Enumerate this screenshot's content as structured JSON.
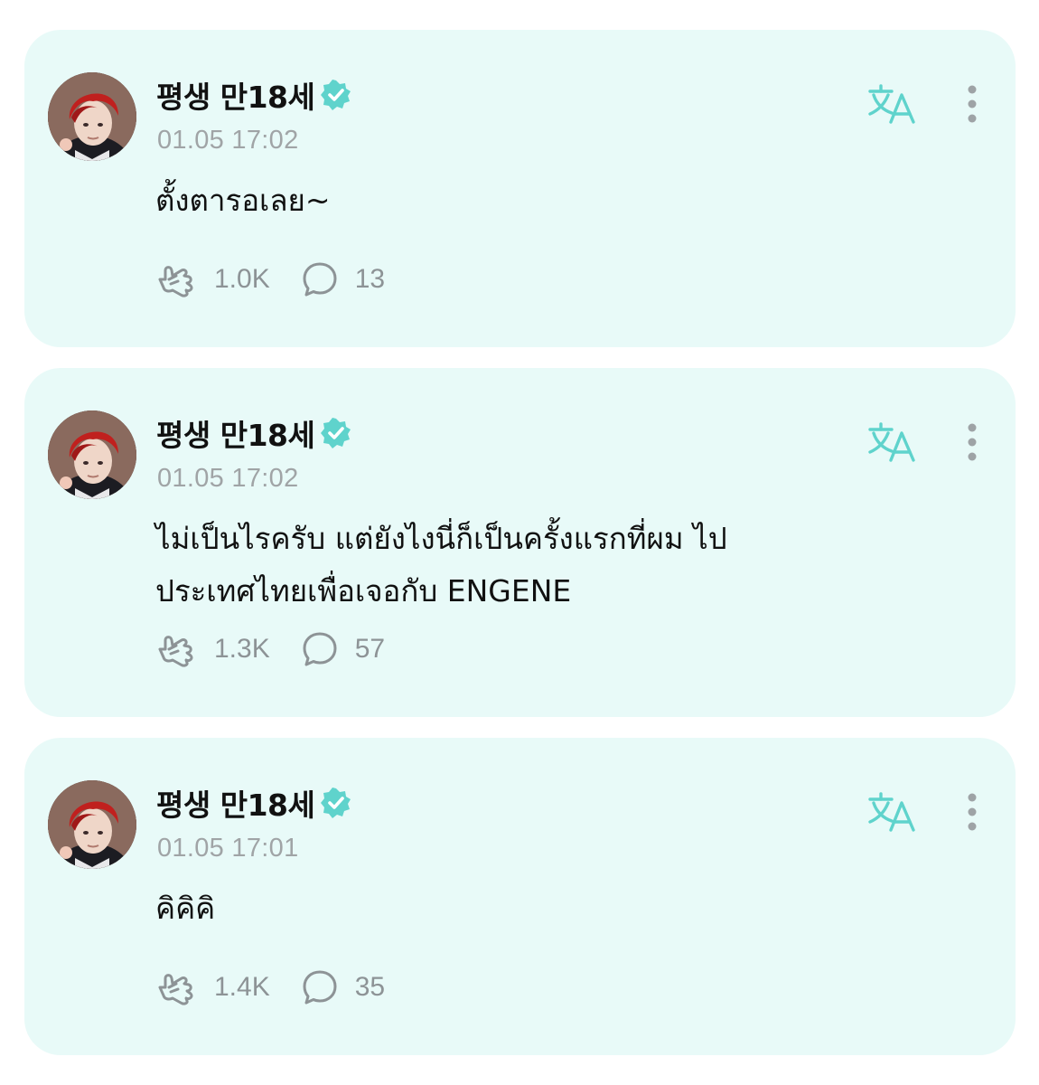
{
  "accent_color": "#5fd3cc",
  "posts": [
    {
      "author": "평생 만18세",
      "verified_icon": "verified-badge-icon",
      "timestamp": "01.05 17:02",
      "text": "ตั้งตารอเลย~",
      "likes": "1.0K",
      "comments": "13"
    },
    {
      "author": "평생 만18세",
      "verified_icon": "verified-badge-icon",
      "timestamp": "01.05 17:02",
      "text": "ไม่เป็นไรครับ แต่ยังไงนี่ก็เป็นครั้งแรกที่ผม ไป\nประเทศไทยเพื่อเจอกับ ENGENE",
      "likes": "1.3K",
      "comments": "57"
    },
    {
      "author": "평생 만18세",
      "verified_icon": "verified-badge-icon",
      "timestamp": "01.05 17:01",
      "text": "คิคิคิ",
      "likes": "1.4K",
      "comments": "35"
    }
  ],
  "icons": {
    "translate": "translate-icon",
    "more": "more-vertical-icon",
    "like": "like-cheer-icon",
    "comment": "comment-bubble-icon"
  }
}
